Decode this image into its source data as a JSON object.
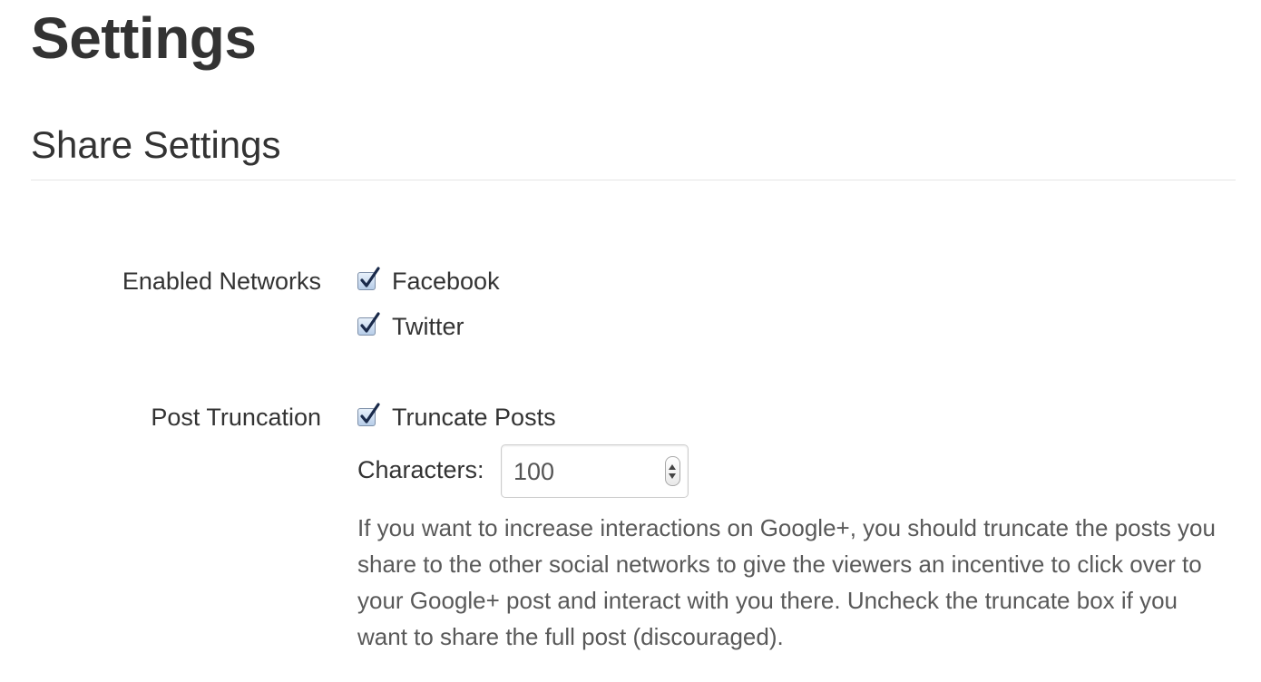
{
  "page": {
    "title": "Settings"
  },
  "section": {
    "title": "Share Settings"
  },
  "enabled_networks": {
    "label": "Enabled Networks",
    "options": [
      {
        "label": "Facebook",
        "checked": true
      },
      {
        "label": "Twitter",
        "checked": true
      }
    ]
  },
  "post_truncation": {
    "label": "Post Truncation",
    "truncate": {
      "label": "Truncate Posts",
      "checked": true
    },
    "characters": {
      "label": "Characters:",
      "value": "100"
    },
    "help_text": "If you want to increase interactions on Google+, you should truncate the posts you share to the other social networks to give the viewers an incentive to click over to your Google+ post and interact with you there. Uncheck the truncate box if you want to share the full post (discouraged)."
  },
  "colors": {
    "text": "#333333",
    "help_text": "#595959",
    "checkmark": "#1a2a4a",
    "checkbox_fill": "#c9dcf1",
    "divider": "#e5e5e5"
  },
  "icons": {
    "checkbox": "checkmark-icon",
    "stepper": "up-down-spinner-icon"
  }
}
